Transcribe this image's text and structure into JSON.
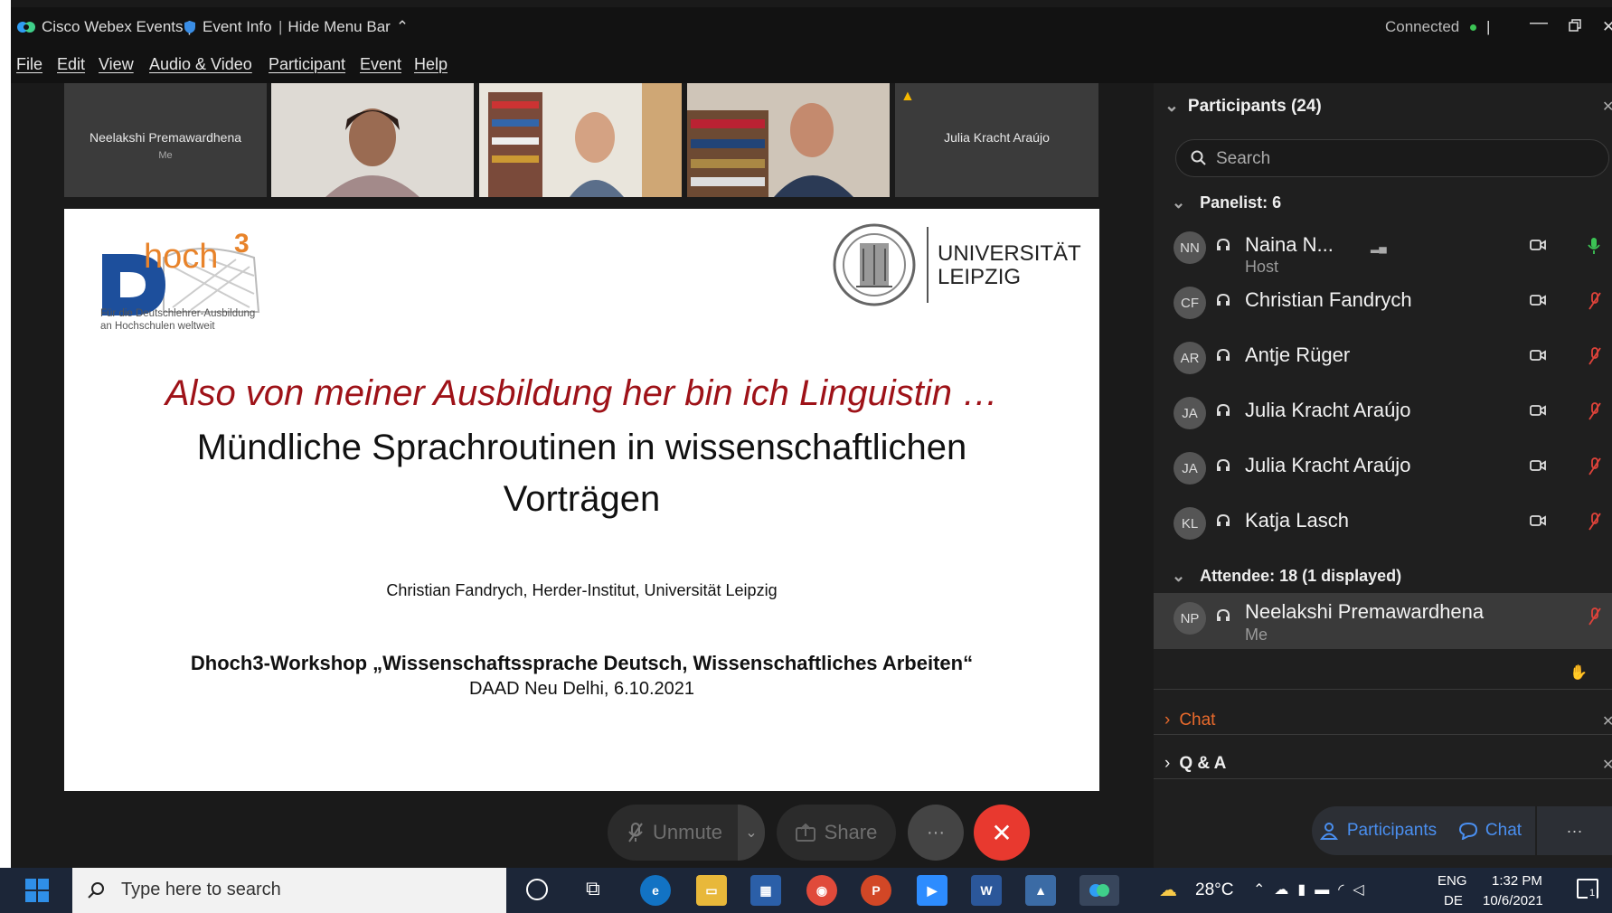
{
  "window": {
    "app_title": "Cisco Webex Events |",
    "event_info": "Event Info",
    "hide_menu_bar": "Hide Menu Bar",
    "status": "Connected"
  },
  "menu": [
    "File",
    "Edit",
    "View",
    "Audio & Video",
    "Participant",
    "Event",
    "Help"
  ],
  "video_strip": {
    "self_name": "Neelakshi Premawardhena",
    "self_sub": "Me",
    "right_name": "Julia Kracht Araújo"
  },
  "slide": {
    "logo_text": "hoch",
    "logo_superscript": "3",
    "logo_tagline_1": "Für die Deutschlehrer-Ausbildung",
    "logo_tagline_2": "an Hochschulen weltweit",
    "uni_line_1": "UNIVERSITÄT",
    "uni_line_2": "LEIPZIG",
    "title_red": "Also von meiner Ausbildung her bin ich Linguistin …",
    "title_line_2": "Mündliche Sprachroutinen in wissenschaftlichen",
    "title_line_3": "Vorträgen",
    "author": "Christian Fandrych, Herder-Institut, Universität Leipzig",
    "workshop": "Dhoch3-Workshop „Wissenschaftssprache Deutsch, Wissenschaftliches Arbeiten“",
    "date_place": "DAAD Neu Delhi, 6.10.2021"
  },
  "controls": {
    "unmute": "Unmute",
    "share": "Share",
    "more": "···"
  },
  "panel": {
    "header": "Participants (24)",
    "search_placeholder": "Search",
    "panelist_header": "Panelist: 6",
    "attendee_header": "Attendee: 18 (1 displayed)",
    "panelists": [
      {
        "initials": "NN",
        "name": "Naina N...",
        "role": "Host"
      },
      {
        "initials": "CF",
        "name": "Christian Fandrych",
        "role": ""
      },
      {
        "initials": "AR",
        "name": "Antje Rüger",
        "role": ""
      },
      {
        "initials": "JA",
        "name": "Julia Kracht Araújo",
        "role": ""
      },
      {
        "initials": "JA",
        "name": "Julia Kracht Araújo",
        "role": ""
      },
      {
        "initials": "KL",
        "name": "Katja Lasch",
        "role": ""
      }
    ],
    "attendee": {
      "initials": "NP",
      "name": "Neelakshi Premawardhena",
      "role": "Me"
    },
    "chat_section": "Chat",
    "qa_section": "Q & A",
    "participants_button": "Participants",
    "chat_button": "Chat"
  },
  "taskbar": {
    "search_placeholder": "Type here to search",
    "temperature": "28°C",
    "lang_1": "ENG",
    "lang_2": "DE",
    "time": "1:32 PM",
    "date": "10/6/2021",
    "notification_count": "1"
  },
  "colors": {
    "accent_blue": "#4a8ff0",
    "chat_orange": "#e86a2c",
    "end_red": "#e8392f",
    "connected_green": "#3cc455",
    "mic_muted_red": "#e0433a",
    "slide_title_red": "#9e1218"
  }
}
